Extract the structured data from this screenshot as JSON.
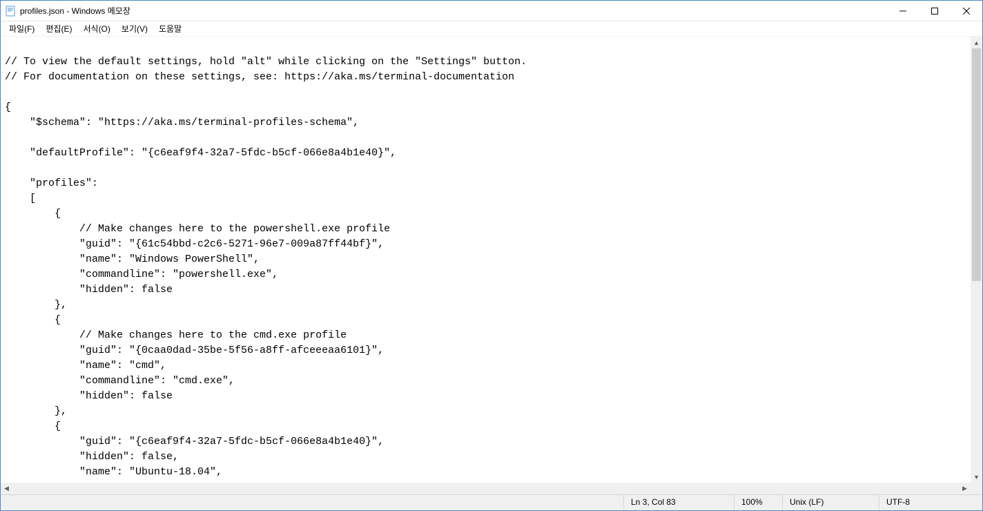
{
  "title": "profiles.json - Windows 메모장",
  "menu": {
    "file": "파일(F)",
    "edit": "편집(E)",
    "format": "서식(O)",
    "view": "보기(V)",
    "help": "도움말"
  },
  "text": "\n// To view the default settings, hold \"alt\" while clicking on the \"Settings\" button.\n// For documentation on these settings, see: https://aka.ms/terminal-documentation\n\n{\n    \"$schema\": \"https://aka.ms/terminal-profiles-schema\",\n\n    \"defaultProfile\": \"{c6eaf9f4-32a7-5fdc-b5cf-066e8a4b1e40}\",\n\n    \"profiles\":\n    [\n        {\n            // Make changes here to the powershell.exe profile\n            \"guid\": \"{61c54bbd-c2c6-5271-96e7-009a87ff44bf}\",\n            \"name\": \"Windows PowerShell\",\n            \"commandline\": \"powershell.exe\",\n            \"hidden\": false\n        },\n        {\n            // Make changes here to the cmd.exe profile\n            \"guid\": \"{0caa0dad-35be-5f56-a8ff-afceeeaa6101}\",\n            \"name\": \"cmd\",\n            \"commandline\": \"cmd.exe\",\n            \"hidden\": false\n        },\n        {\n            \"guid\": \"{c6eaf9f4-32a7-5fdc-b5cf-066e8a4b1e40}\",\n            \"hidden\": false,\n            \"name\": \"Ubuntu-18.04\",",
  "status": {
    "position": "Ln 3, Col 83",
    "zoom": "100%",
    "eol": "Unix (LF)",
    "encoding": "UTF-8"
  }
}
